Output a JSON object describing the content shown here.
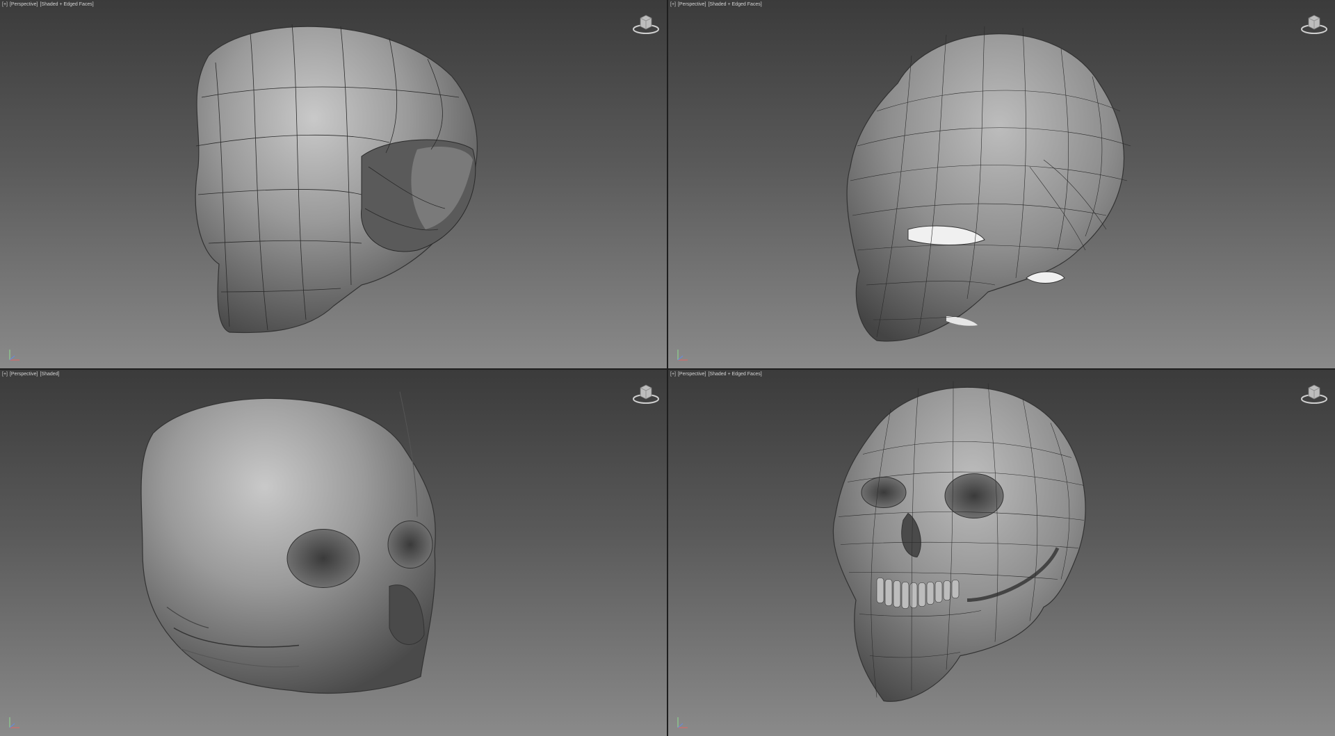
{
  "viewports": {
    "top_left": {
      "menu": "[+]",
      "view": "[Perspective]",
      "shading": "[Shaded + Edged Faces]"
    },
    "top_right": {
      "menu": "[+]",
      "view": "[Perspective]",
      "shading": "[Shaded + Edged Faces]"
    },
    "bottom_left": {
      "menu": "[+]",
      "view": "[Perspective]",
      "shading": "[Shaded]"
    },
    "bottom_right": {
      "menu": "[+]",
      "view": "[Perspective]",
      "shading": "[Shaded + Edged Faces]"
    }
  },
  "icons": {
    "viewcube": "viewcube-icon",
    "axis": "axis-tripod-icon"
  },
  "colors": {
    "viewport_top": "#3b3b3b",
    "viewport_bottom": "#8a8a8a",
    "mesh_base": "#9a9a9a",
    "wire": "#2a2a2a",
    "label": "#d4d4d4"
  }
}
